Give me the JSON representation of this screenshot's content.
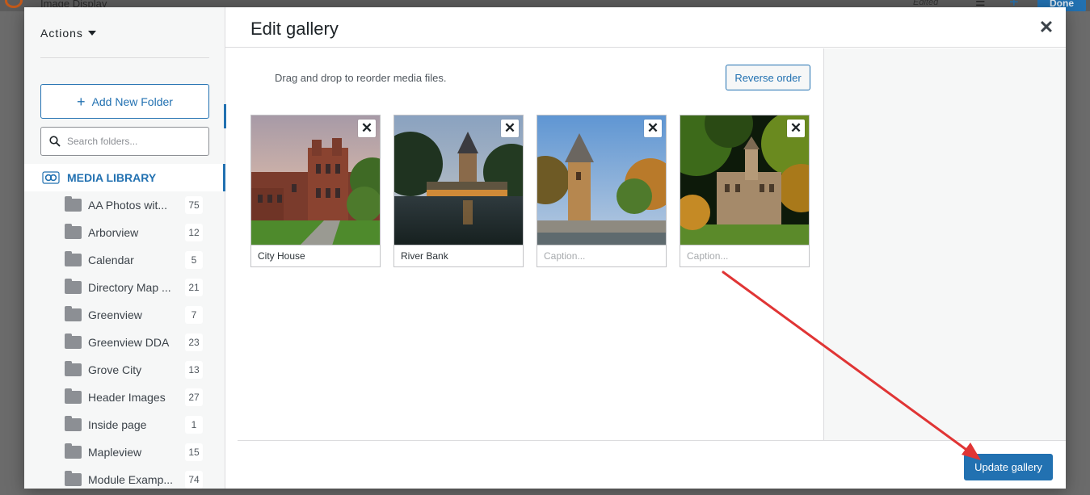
{
  "background": {
    "app_title": "Image Display",
    "edited_label": "Edited",
    "done_label": "Done"
  },
  "sidebar": {
    "actions_label": "Actions",
    "add_folder_label": "Add New Folder",
    "search_placeholder": "Search folders...",
    "media_library_label": "MEDIA LIBRARY",
    "folders": [
      {
        "name": "AA Photos wit...",
        "count": "75"
      },
      {
        "name": "Arborview",
        "count": "12"
      },
      {
        "name": "Calendar",
        "count": "5"
      },
      {
        "name": "Directory Map ...",
        "count": "21"
      },
      {
        "name": "Greenview",
        "count": "7"
      },
      {
        "name": "Greenview DDA",
        "count": "23"
      },
      {
        "name": "Grove City",
        "count": "13"
      },
      {
        "name": "Header Images",
        "count": "27"
      },
      {
        "name": "Inside page",
        "count": "1"
      },
      {
        "name": "Mapleview",
        "count": "15"
      },
      {
        "name": "Module Examp...",
        "count": "74"
      }
    ]
  },
  "header": {
    "title": "Edit gallery",
    "close_icon": "close-icon"
  },
  "content": {
    "instructions": "Drag and drop to reorder media files.",
    "reverse_label": "Reverse order",
    "caption_placeholder": "Caption...",
    "items": [
      {
        "caption": "City House",
        "image": "brick-castle-building"
      },
      {
        "caption": "River Bank",
        "image": "tower-by-river-dusk"
      },
      {
        "caption": "",
        "image": "stone-tower-autumn"
      },
      {
        "caption": "",
        "image": "courthouse-through-trees"
      }
    ]
  },
  "footer": {
    "update_label": "Update gallery"
  },
  "colors": {
    "accent": "#2271b1",
    "annotation_arrow": "#e03535"
  }
}
